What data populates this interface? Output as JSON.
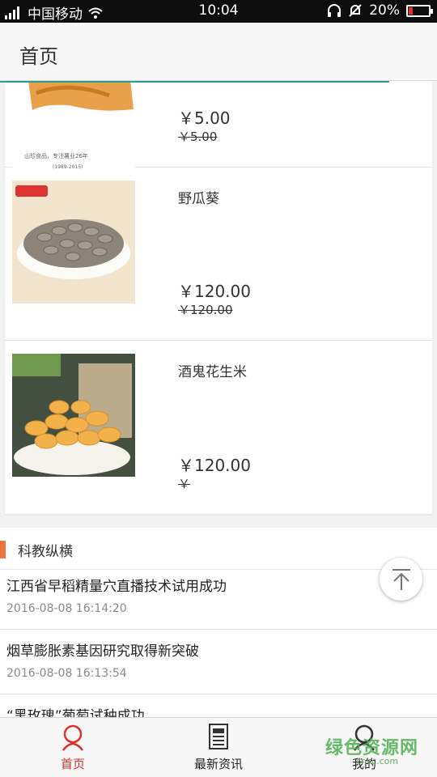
{
  "status_bar": {
    "carrier": "中国移动",
    "time": "10:04",
    "battery": "20%",
    "battery_level": 0.2
  },
  "header": {
    "title": "首页"
  },
  "page_load_progress": 0.89,
  "products": [
    {
      "name": "",
      "price": "￥5.00",
      "original_price": "￥5.00",
      "image_caption": "山珍食品，专注薯业26年",
      "image_years": "(1989-2015)"
    },
    {
      "name": "野瓜葵",
      "price": "￥120.00",
      "original_price": "￥120.00",
      "image_badge": ""
    },
    {
      "name": "酒鬼花生米",
      "price": "￥120.00",
      "original_price": "￥"
    }
  ],
  "news": {
    "section_title": "科教纵横",
    "items": [
      {
        "title": "江西省早稻精量穴直播技术试用成功",
        "date": "2016-08-08 16:14:20"
      },
      {
        "title": "烟草膨胀素基因研究取得新突破",
        "date": "2016-08-08 16:13:54"
      },
      {
        "title": "“黑玫瑰”葡萄试种成功",
        "date": ""
      }
    ]
  },
  "tabs": [
    {
      "label": "首页",
      "icon": "home-icon",
      "active": true
    },
    {
      "label": "最新资讯",
      "icon": "news-icon",
      "active": false
    },
    {
      "label": "我的",
      "icon": "profile-icon",
      "active": false
    }
  ],
  "watermark": {
    "text": "绿色资源网",
    "domain": "cncc.com"
  },
  "colors": {
    "accent": "#f07440",
    "active_tab": "#d9322a",
    "progress": "#2a9d8f"
  }
}
